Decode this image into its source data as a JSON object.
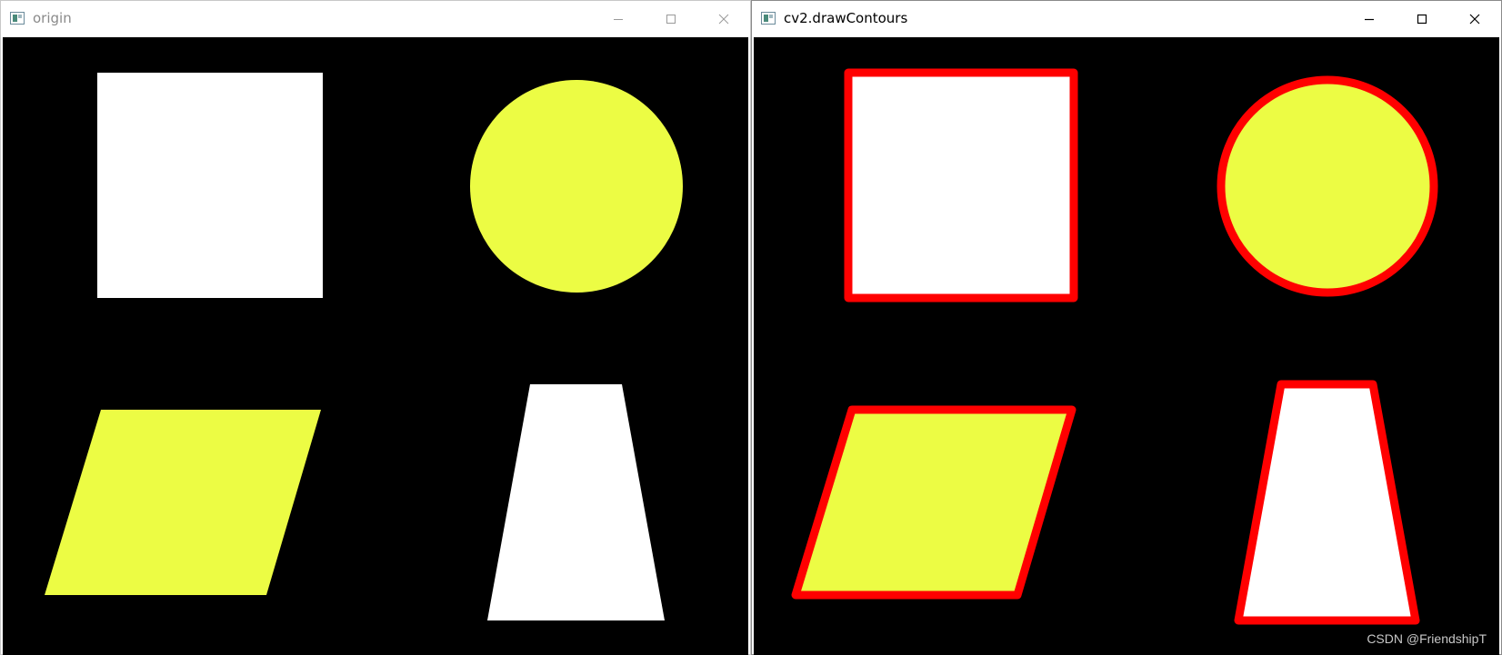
{
  "colors": {
    "canvas_bg": "#000000",
    "white_shape": "#ffffff",
    "yellow_shape": "#ecfc44",
    "contour": "#ff0000"
  },
  "windows": [
    {
      "id": "left",
      "title": "origin",
      "active": false,
      "shapes": [
        "square",
        "circle",
        "parallelogram",
        "trapezoid"
      ],
      "contours": false
    },
    {
      "id": "right",
      "title": "cv2.drawContours",
      "active": true,
      "shapes": [
        "square",
        "circle",
        "parallelogram",
        "trapezoid"
      ],
      "contours": true
    }
  ],
  "icons": {
    "app": "opencv-window-icon",
    "minimize": "minimize-icon",
    "maximize": "maximize-icon",
    "close": "close-icon"
  },
  "watermark": "CSDN @FriendshipT"
}
